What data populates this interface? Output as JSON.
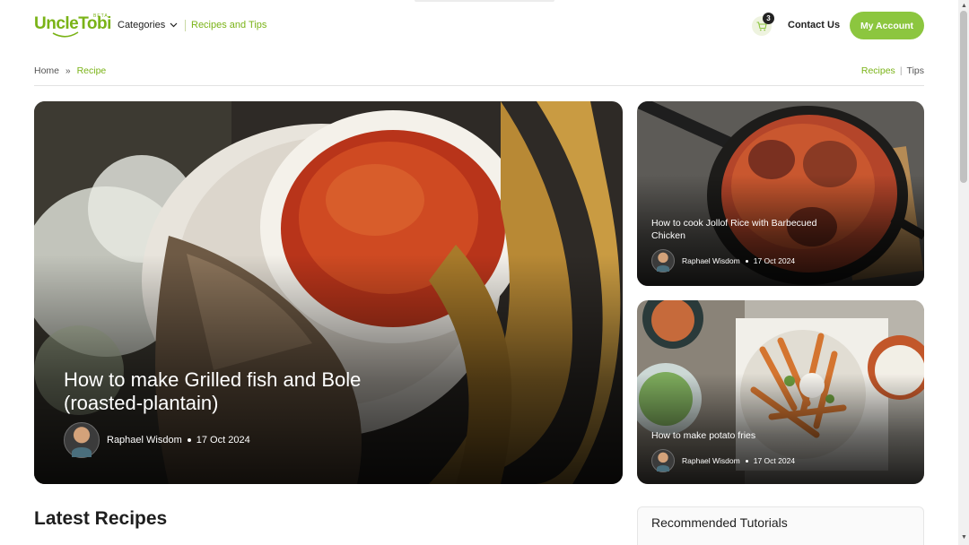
{
  "header": {
    "logo_text": "UncleTobi",
    "logo_beta": "BETA",
    "nav_categories": "Categories",
    "nav_recipes_tips": "Recipes and Tips",
    "cart_count": "3",
    "contact_label": "Contact Us",
    "account_label": "My Account",
    "icons": {
      "chevron": "chevron-down-icon",
      "cart": "cart-icon"
    }
  },
  "breadcrumb": {
    "home": "Home",
    "current": "Recipe"
  },
  "filters": {
    "recipes": "Recipes",
    "tips": "Tips"
  },
  "featured": {
    "title": "How to make Grilled fish and Bole (roasted-plantain)",
    "author": "Raphael Wisdom",
    "date": "17 Oct 2024"
  },
  "side_cards": [
    {
      "title": "How to cook Jollof Rice with Barbecued Chicken",
      "author": "Raphael Wisdom",
      "date": "17 Oct 2024"
    },
    {
      "title": "How to make potato fries",
      "author": "Raphael Wisdom",
      "date": "17 Oct 2024"
    }
  ],
  "sections": {
    "latest_recipes": "Latest Recipes",
    "recommended_tutorials": "Recommended Tutorials"
  },
  "colors": {
    "brand_green": "#8cc63f",
    "link_green": "#7ab317",
    "text_dark": "#1e1e1e"
  }
}
